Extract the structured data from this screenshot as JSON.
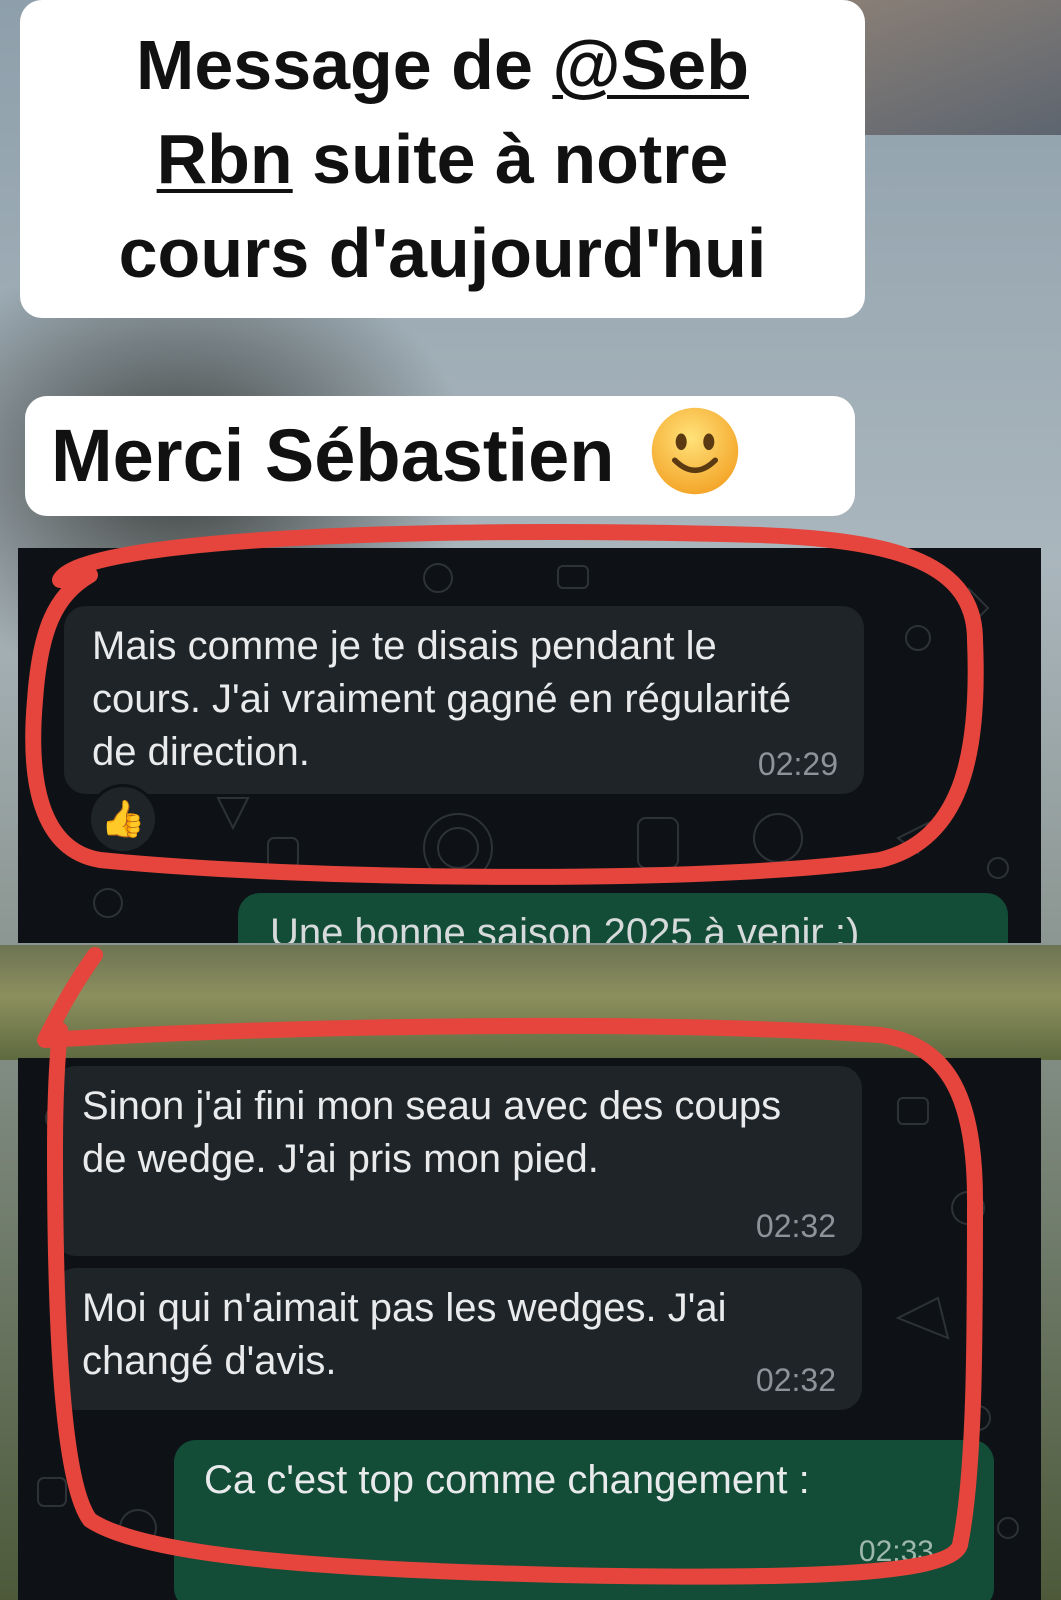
{
  "caption_top": {
    "line1_text": "Message de ",
    "mention_part1": "@Seb",
    "mention_part2": "Rbn",
    "line2_rest": " suite à notre",
    "line3": "cours d'aujourd'hui"
  },
  "caption_thanks": {
    "text": "Merci Sébastien",
    "emoji": "slightly-smiling-face-icon"
  },
  "chat1": {
    "incoming": {
      "text": "Mais comme je te disais pendant le cours. J'ai vraiment gagné en régularité de direction.",
      "time": "02:29",
      "reaction": "👍"
    },
    "outgoing_partial": "Une bonne saison 2025 à venir :)"
  },
  "chat2": {
    "messages": [
      {
        "text": "Sinon j'ai fini mon seau avec des coups de wedge. J'ai pris mon pied.",
        "time": "02:32"
      },
      {
        "text": "Moi qui n'aimait pas les wedges. J'ai changé d'avis.",
        "time": "02:32"
      }
    ],
    "outgoing": {
      "text": "Ca c'est top comme changement :",
      "time": "02:33"
    }
  },
  "colors": {
    "annotation_red": "#e5453c",
    "incoming_bubble": "#1f2428",
    "outgoing_bubble": "#134d37",
    "chat_background": "#0e1216"
  }
}
